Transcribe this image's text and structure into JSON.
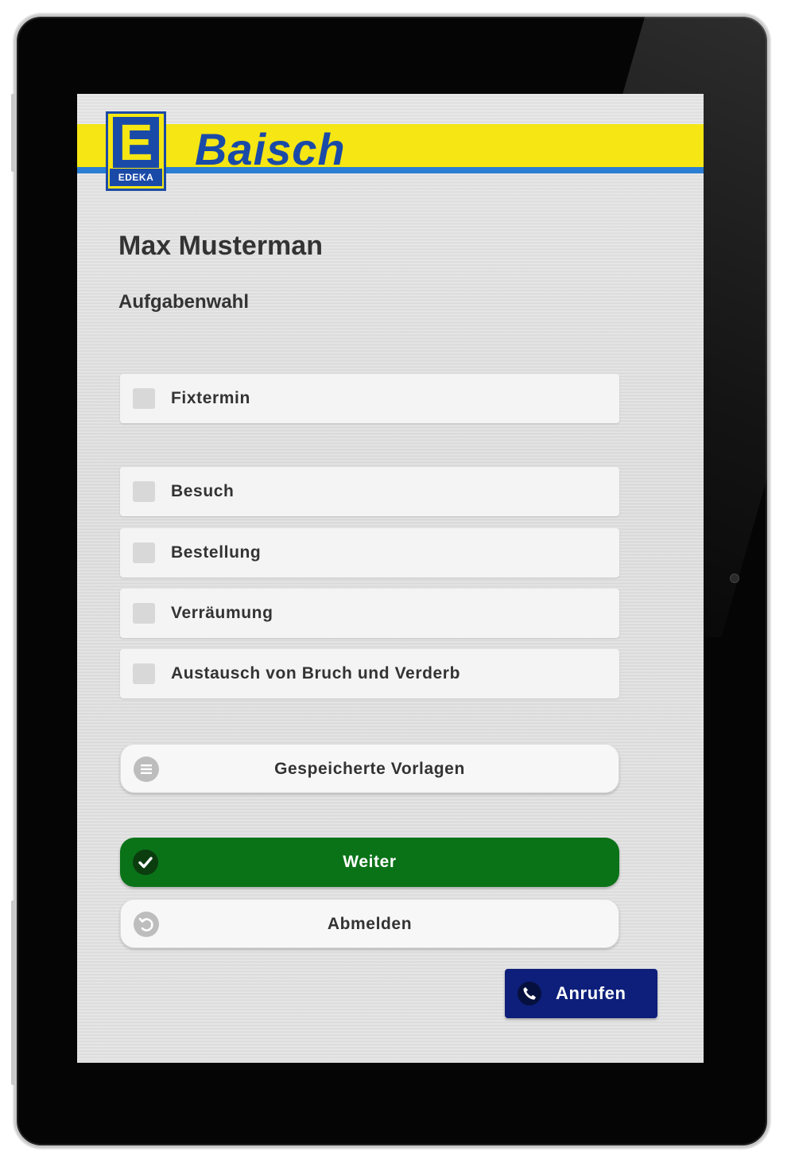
{
  "brand": {
    "logo_letter": "E",
    "logo_word": "EDEKA",
    "name": "Baisch"
  },
  "user": {
    "name": "Max Musterman"
  },
  "page": {
    "title": "Aufgabenwahl"
  },
  "options": [
    {
      "label": "Fixtermin",
      "checked": false
    },
    {
      "label": "Besuch",
      "checked": false
    },
    {
      "label": "Bestellung",
      "checked": false
    },
    {
      "label": "Verräumung",
      "checked": false
    },
    {
      "label": "Austausch von Bruch und Verderb",
      "checked": false
    }
  ],
  "buttons": {
    "templates": {
      "label": "Gespeicherte Vorlagen",
      "icon": "list-icon"
    },
    "next": {
      "label": "Weiter",
      "icon": "check-icon"
    },
    "logout": {
      "label": "Abmelden",
      "icon": "undo-icon"
    },
    "call": {
      "label": "Anrufen",
      "icon": "phone-icon"
    }
  },
  "colors": {
    "brand_yellow": "#f5e614",
    "brand_blue": "#1a4aa8",
    "next_green": "#0a7318",
    "call_navy": "#0d1f7a"
  }
}
